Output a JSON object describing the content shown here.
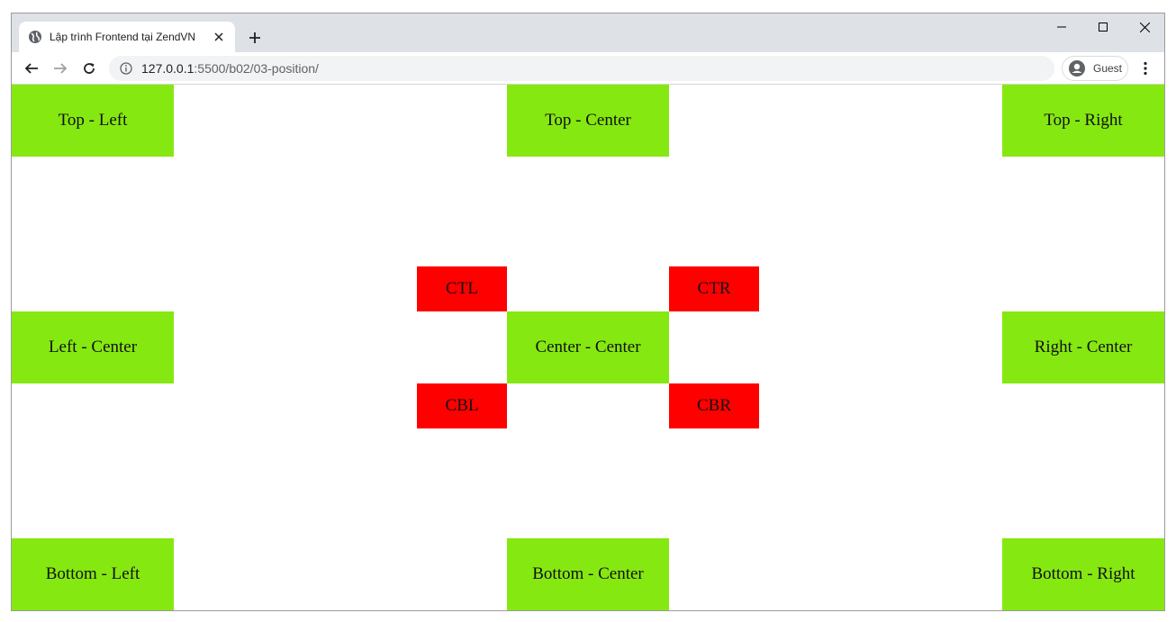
{
  "browser": {
    "tab": {
      "title": "Lập trình Frontend tại ZendVN"
    },
    "url_host": "127.0.0.1",
    "url_path": ":5500/b02/03-position/",
    "profile_label": "Guest"
  },
  "page": {
    "boxes": {
      "top_left": "Top - Left",
      "top_center": "Top - Center",
      "top_right": "Top - Right",
      "left_center": "Left - Center",
      "center_center": "Center - Center",
      "right_center": "Right - Center",
      "bottom_left": "Bottom - Left",
      "bottom_center": "Bottom - Center",
      "bottom_right": "Bottom - Right"
    },
    "corners": {
      "ctl": "CTL",
      "ctr": "CTR",
      "cbl": "CBL",
      "cbr": "CBR"
    },
    "colors": {
      "green_box": "#86e811",
      "red_box": "#ff0000"
    }
  }
}
